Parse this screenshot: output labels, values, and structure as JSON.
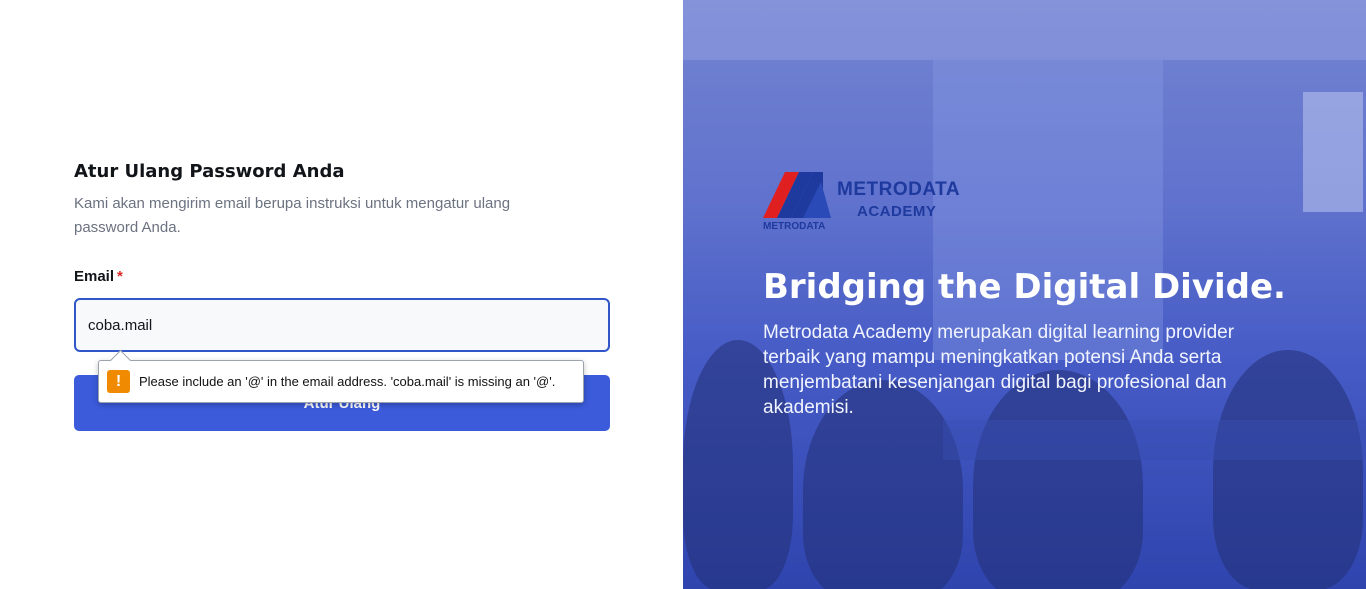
{
  "form": {
    "title": "Atur Ulang Password Anda",
    "description": "Kami akan mengirim email berupa instruksi untuk mengatur ulang password Anda.",
    "email_label": "Email",
    "required_mark": "*",
    "email_value": "coba.mail",
    "submit_label": "Atur Ulang"
  },
  "tooltip": {
    "icon": "!",
    "message": "Please include an '@' in the email address. 'coba.mail' is missing an '@'."
  },
  "hero": {
    "logo_name": "METRODATA",
    "logo_sub": "ACADEMY",
    "logo_small": "METRODATA",
    "headline": "Bridging the Digital Divide.",
    "body": "Metrodata Academy merupakan digital learning provider terbaik yang mampu meningkatkan potensi Anda serta menjembatani kesenjangan digital bagi profesional dan akademisi."
  },
  "colors": {
    "primary": "#3b5bdb",
    "input_border": "#3056c9",
    "required": "#dc2626",
    "warning": "#f08a00"
  }
}
